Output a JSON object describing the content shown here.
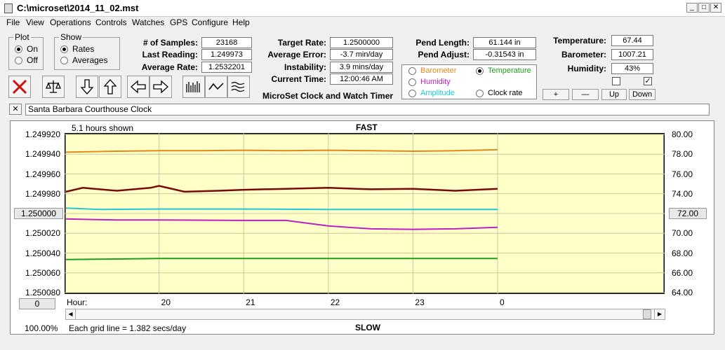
{
  "window": {
    "title": "C:\\microset\\2014_11_02.mst"
  },
  "menu": [
    "File",
    "View",
    "Operations",
    "Controls",
    "Watches",
    "GPS",
    "Configure",
    "Help"
  ],
  "plot": {
    "legend": "Plot",
    "on": "On",
    "off": "Off"
  },
  "show": {
    "legend": "Show",
    "rates": "Rates",
    "averages": "Averages"
  },
  "stats": {
    "samples_label": "# of Samples:",
    "samples": "23168",
    "last_label": "Last Reading:",
    "last": "1.249973",
    "avg_rate_label": "Average Rate:",
    "avg_rate": "1.2532201",
    "target_label": "Target Rate:",
    "target": "1.2500000",
    "avg_err_label": "Average Error:",
    "avg_err": "-3.7 min/day",
    "instab_label": "Instability:",
    "instab": "3.9 mins/day",
    "time_label": "Current Time:",
    "time": "12:00:46 AM",
    "pend_len_label": "Pend Length:",
    "pend_len": "61.144 in",
    "pend_adj_label": "Pend Adjust:",
    "pend_adj": "-0.31543 in",
    "temp_label": "Temperature:",
    "temp": "67.44",
    "baro_label": "Barometer:",
    "baro": "1007.21",
    "hum_label": "Humidity:",
    "hum": "43%"
  },
  "app_name": "MicroSet Clock and Watch Timer",
  "sensors": {
    "barometer": "Barometer",
    "temperature": "Temperature",
    "humidity": "Humidity",
    "amplitude": "Amplitude",
    "clock_rate": "Clock rate"
  },
  "small_buttons": {
    "plus": "+",
    "minus": "—",
    "up": "Up",
    "down": "Down"
  },
  "clock_name": "Santa Barbara Courthouse Clock",
  "colors": {
    "barometer": "#e08a1e",
    "temperature": "#1aa01a",
    "humidity": "#c020c0",
    "amplitude": "#20c8d8",
    "rate": "#7a0a0a"
  },
  "chart_data": {
    "type": "line",
    "title": "FAST",
    "bottom_label": "SLOW",
    "hours_shown": "5.1 hours shown",
    "grid_note": "Each grid line = 1.382 secs/day",
    "zoom": "100.00%",
    "left_ticks": [
      "1.249920",
      "1.249940",
      "1.249960",
      "1.249980",
      "1.250000",
      "1.250020",
      "1.250040",
      "1.250060",
      "1.250080"
    ],
    "right_ticks": [
      "80.00",
      "78.00",
      "76.00",
      "74.00",
      "72.00",
      "70.00",
      "68.00",
      "66.00",
      "64.00"
    ],
    "left_center_button": "1.250000",
    "right_center_button": "72.00",
    "bottom_left_button": "0",
    "x_label": "Hour:",
    "x_ticks": [
      "20",
      "21",
      "22",
      "23",
      "0"
    ],
    "x_hours": [
      18.9,
      20,
      21,
      22,
      23,
      24
    ],
    "series": [
      {
        "name": "Barometer",
        "color": "#e08a1e",
        "x": [
          18.9,
          19.5,
          20,
          20.5,
          21,
          21.5,
          22,
          22.5,
          23,
          23.5,
          24
        ],
        "y": [
          78.2,
          78.3,
          78.35,
          78.35,
          78.4,
          78.35,
          78.4,
          78.35,
          78.3,
          78.35,
          78.45
        ]
      },
      {
        "name": "Rate",
        "color": "#7a0a0a",
        "x": [
          18.9,
          19.1,
          19.5,
          19.9,
          20,
          20.3,
          20.7,
          21,
          21.5,
          22,
          22.5,
          23,
          23.5,
          24
        ],
        "y": [
          74.2,
          74.6,
          74.3,
          74.6,
          74.8,
          74.2,
          74.3,
          74.4,
          74.5,
          74.6,
          74.45,
          74.5,
          74.3,
          74.5
        ]
      },
      {
        "name": "Amplitude",
        "color": "#20c8d8",
        "x": [
          18.9,
          19.3,
          20,
          21,
          22,
          23,
          24
        ],
        "y": [
          72.55,
          72.4,
          72.45,
          72.45,
          72.4,
          72.4,
          72.4
        ]
      },
      {
        "name": "Humidity",
        "color": "#c020c0",
        "x": [
          18.9,
          19.5,
          20,
          21,
          21.5,
          22,
          22.5,
          23,
          23.5,
          24
        ],
        "y": [
          71.45,
          71.35,
          71.35,
          71.3,
          71.3,
          70.75,
          70.45,
          70.4,
          70.45,
          70.6
        ]
      },
      {
        "name": "Temperature",
        "color": "#1aa01a",
        "x": [
          18.9,
          19.5,
          20,
          21,
          22,
          23,
          24
        ],
        "y": [
          67.35,
          67.4,
          67.45,
          67.45,
          67.45,
          67.45,
          67.45
        ]
      }
    ],
    "ylim_right": [
      64,
      80
    ]
  }
}
